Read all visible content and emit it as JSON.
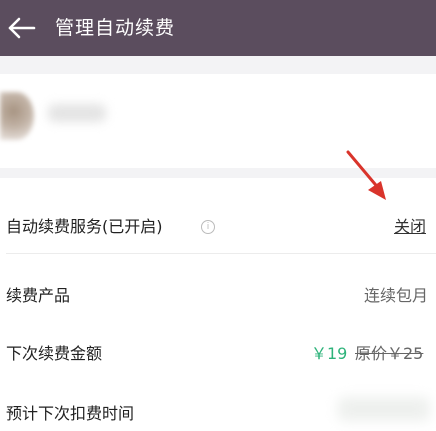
{
  "header": {
    "back_icon": "arrow-left-icon",
    "title": "管理自动续费",
    "bg_color": "#5b4d5e"
  },
  "service": {
    "label": "自动续费服务(已开启)",
    "info_icon": "info-circle-icon",
    "close_label": "关闭"
  },
  "product": {
    "label": "续费产品",
    "value": "连续包月"
  },
  "amount": {
    "label": "下次续费金额",
    "price": "￥19",
    "original_price": "原价￥25",
    "price_color": "#2db37a"
  },
  "next_time": {
    "label": "预计下次扣费时间"
  },
  "annotation": {
    "arrow_icon": "red-pointer-arrow-icon",
    "arrow_color": "#d9342b"
  }
}
